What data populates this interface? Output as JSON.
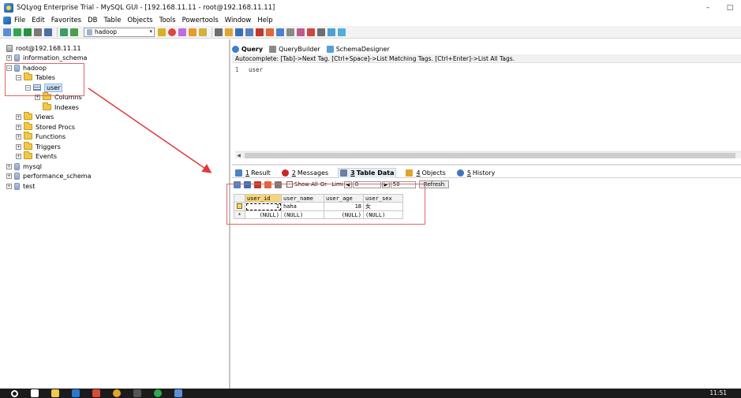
{
  "window": {
    "title": "SQLyog Enterprise Trial - MySQL GUI - [192.168.11.11 - root@192.168.11.11]",
    "controls": [
      "–",
      "□"
    ]
  },
  "menu": [
    "File",
    "Edit",
    "Favorites",
    "DB",
    "Table",
    "Objects",
    "Tools",
    "Powertools",
    "Window",
    "Help"
  ],
  "toolbar": {
    "db_selector": "hadoop"
  },
  "tree": {
    "connection": "root@192.168.11.11",
    "items": [
      {
        "label": "information_schema"
      },
      {
        "label": "hadoop"
      },
      {
        "label": "Tables"
      },
      {
        "label": "user"
      },
      {
        "label": "Columns"
      },
      {
        "label": "Indexes"
      },
      {
        "label": "Views"
      },
      {
        "label": "Stored Procs"
      },
      {
        "label": "Functions"
      },
      {
        "label": "Triggers"
      },
      {
        "label": "Events"
      },
      {
        "label": "mysql"
      },
      {
        "label": "performance_schema"
      },
      {
        "label": "test"
      }
    ],
    "expander_plus": "+",
    "expander_minus": "−"
  },
  "query_tabs": [
    {
      "label": "Query",
      "color": "#3b7fd1"
    },
    {
      "label": "QueryBuilder",
      "color": "#8a8a8a"
    },
    {
      "label": "SchemaDesigner",
      "color": "#5aa0d8"
    }
  ],
  "autocomplete_hint": "Autocomplete: [Tab]->Next Tag. [Ctrl+Space]->List Matching Tags. [Ctrl+Enter]->List All Tags.",
  "editor": {
    "line_number": "1",
    "code": "user"
  },
  "result_tabs": [
    {
      "num": "1",
      "label": "Result"
    },
    {
      "num": "2",
      "label": "Messages"
    },
    {
      "num": "3",
      "label": "Table Data"
    },
    {
      "num": "4",
      "label": "Objects"
    },
    {
      "num": "5",
      "label": "History"
    }
  ],
  "data_toolbar": {
    "show_all": "Show All",
    "or_label": "Or",
    "limit_label": "Limi",
    "offset": "0",
    "limit": "50",
    "refresh": "Refresh"
  },
  "grid": {
    "columns": [
      "user_id",
      "user_name",
      "user_age",
      "user_sex"
    ],
    "rows": [
      [
        "1",
        "haha",
        "18",
        "女"
      ],
      [
        "(NULL)",
        "(NULL)",
        "(NULL)",
        "(NULL)"
      ]
    ],
    "new_row_marker": "*"
  },
  "taskbar": {
    "time": "11:51"
  }
}
